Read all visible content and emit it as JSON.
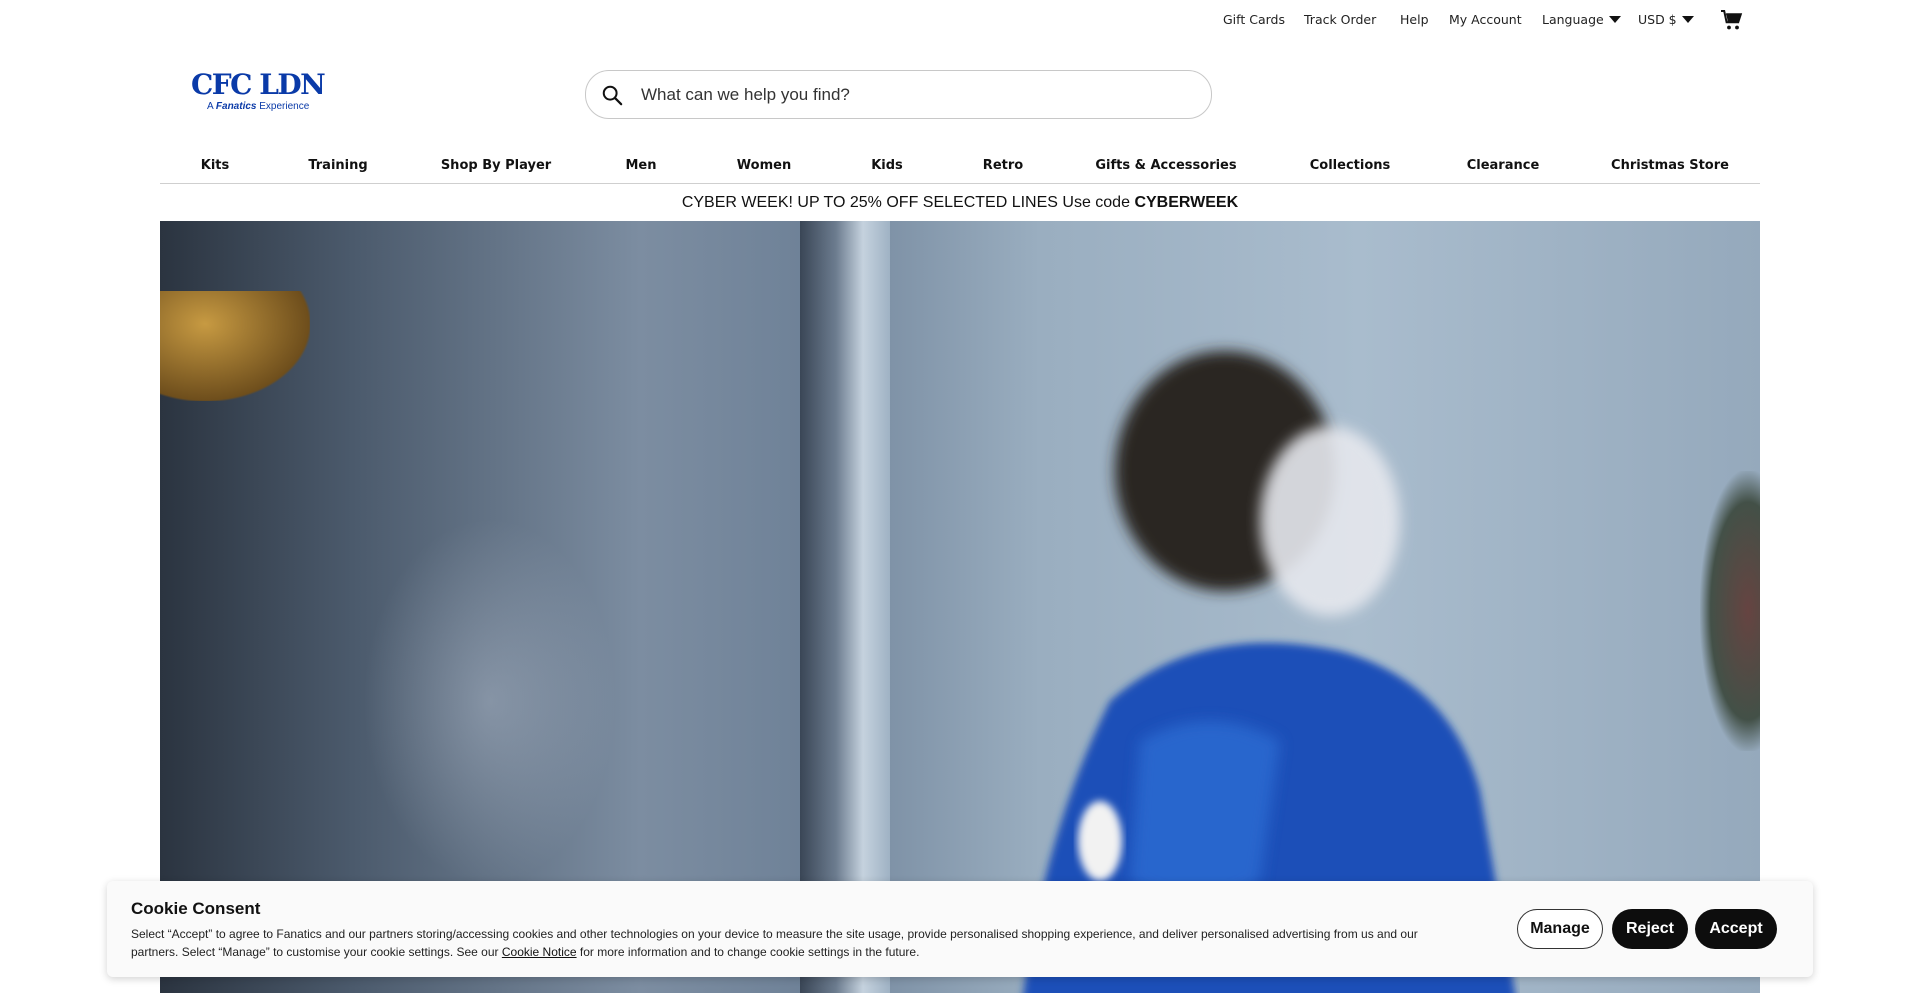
{
  "utility": {
    "gift_cards": "Gift Cards",
    "track_order": "Track Order",
    "help": "Help",
    "my_account": "My Account",
    "language": "Language",
    "currency": "USD $",
    "cart_icon": "cart-icon"
  },
  "logo": {
    "main": "CFC LDN",
    "sub_prefix": "A",
    "sub_brand": "Fanatics",
    "sub_suffix": "Experience"
  },
  "search": {
    "placeholder": "What can we help you find?",
    "icon": "search-icon"
  },
  "nav": {
    "items": [
      "Kits",
      "Training",
      "Shop By Player",
      "Men",
      "Women",
      "Kids",
      "Retro",
      "Gifts & Accessories",
      "Collections",
      "Clearance",
      "Christmas Store"
    ]
  },
  "promo": {
    "text": "CYBER WEEK! UP TO 25% OFF SELECTED LINES Use code",
    "code": "CYBERWEEK"
  },
  "cookie": {
    "title": "Cookie Consent",
    "text_before_link": "Select “Accept” to agree to Fanatics and our partners storing/accessing cookies and other technologies on your device to measure the site usage, provide personalised shopping experience, and deliver personalised advertising from us and our partners. Select “Manage” to customise your cookie settings. See our",
    "link": "Cookie Notice",
    "text_after_link": "for more information and to change cookie settings in the future.",
    "manage": "Manage",
    "reject": "Reject",
    "accept": "Accept"
  },
  "colors": {
    "brand_blue": "#0a3aa8",
    "button_dark": "#0d0d0d"
  }
}
